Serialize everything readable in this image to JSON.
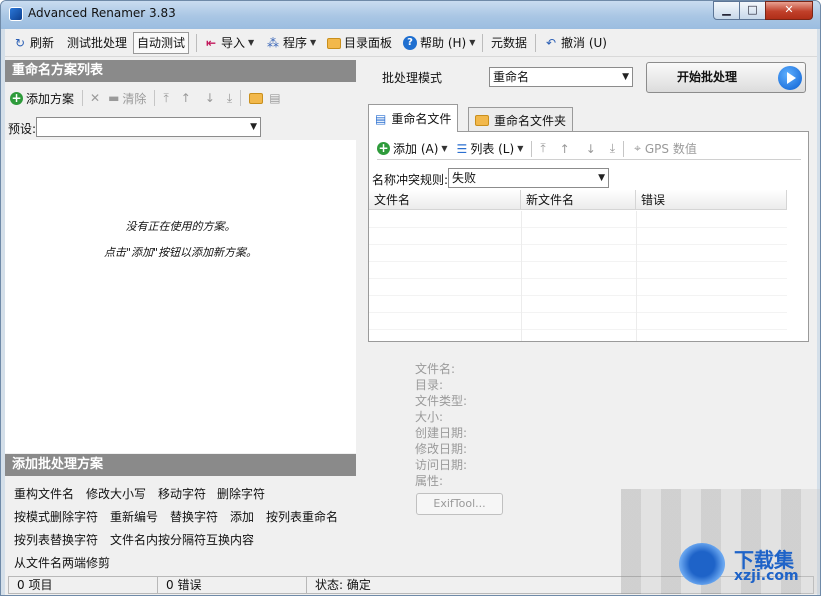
{
  "window": {
    "title": "Advanced Renamer 3.83"
  },
  "toolbar": {
    "refresh": "刷新",
    "test_batch": "测试批处理",
    "auto_test": "自动测试",
    "import": "导入",
    "program": "程序",
    "dir_panel": "目录面板",
    "help": "帮助 (H)",
    "metadata": "元数据",
    "undo": "撤消 (U)"
  },
  "left_panel": {
    "methods_list_title": "重命名方案列表",
    "add_method": "添加方案",
    "clear": "清除",
    "preset_label": "预设:",
    "preset_value": "",
    "empty_line1": "没有正在使用的方案。",
    "empty_line2": "点击\"添加\"按钮以添加新方案。",
    "add_batch_title": "添加批处理方案",
    "methods": [
      "重构文件名",
      "修改大小写",
      "移动字符",
      "删除字符",
      "按模式删除字符",
      "重新编号",
      "替换字符",
      "添加",
      "按列表重命名",
      "按列表替换字符",
      "文件名内按分隔符互换内容",
      "从文件名两端修剪"
    ]
  },
  "right_panel": {
    "batch_mode_label": "批处理模式",
    "batch_mode_value": "重命名",
    "start_button": "开始批处理",
    "tabs": [
      "重命名文件",
      "重命名文件夹"
    ],
    "file_toolbar": {
      "add": "添加 (A)",
      "list": "列表 (L)",
      "gps": "GPS 数值"
    },
    "conflict_label": "名称冲突规则:",
    "conflict_value": "失败",
    "columns": [
      "文件名",
      "新文件名",
      "错误"
    ],
    "info_labels": [
      "文件名:",
      "目录:",
      "文件类型:",
      "大小:",
      "创建日期:",
      "修改日期:",
      "访问日期:",
      "属性:"
    ],
    "exif_button": "ExifTool..."
  },
  "status_bar": {
    "items": "0 项目",
    "errors": "0 错误",
    "state": "状态: 确定"
  },
  "watermark": {
    "text": "下载集",
    "url": "xzji.com"
  }
}
